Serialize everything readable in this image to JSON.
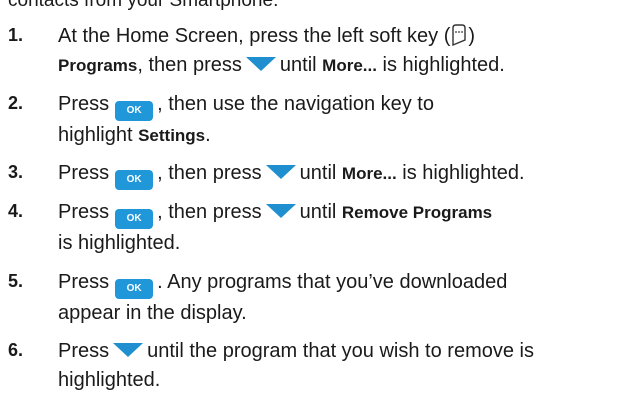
{
  "cutoff_text": "contacts from your Smartphone:",
  "steps": [
    {
      "num": "1.",
      "l1a": "At the Home Screen, press the left soft key (",
      "l1b": ")",
      "l2a": "Programs",
      "l2b": ", then press",
      "l2c": "until",
      "l2d": "More...",
      "l2e": "is highlighted."
    },
    {
      "num": "2.",
      "l1a": "Press",
      "l1b": ", then use the navigation key to",
      "l2a": "highlight",
      "l2b": "Settings",
      "l2c": "."
    },
    {
      "num": "3.",
      "l1a": "Press",
      "l1b": ", then press",
      "l1c": "until",
      "l1d": "More...",
      "l1e": "is highlighted."
    },
    {
      "num": "4.",
      "l1a": "Press",
      "l1b": ", then press",
      "l1c": "until",
      "l1d": "Remove Programs",
      "l2a": "is highlighted."
    },
    {
      "num": "5.",
      "l1a": "Press",
      "l1b": ". Any programs that you’ve downloaded",
      "l2a": "appear in the display."
    },
    {
      "num": "6.",
      "l1a": "Press",
      "l1b": "until the program that you wish to remove is",
      "l2a": "highlighted."
    }
  ],
  "ok_key_label": "OK",
  "icons": {
    "down_arrow": "navigation-down-arrow-icon",
    "ok_key": "ok-key-icon",
    "soft_key": "left-soft-key-icon"
  },
  "colors": {
    "key_blue": "#1f97d8",
    "text": "#1a1a1a"
  }
}
